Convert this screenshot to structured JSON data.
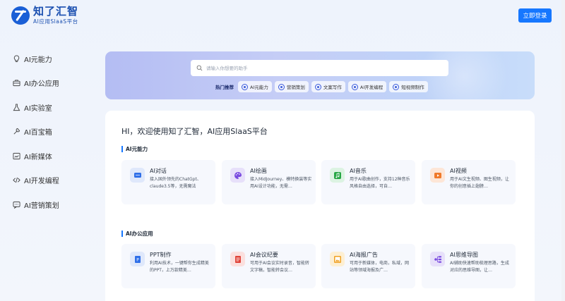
{
  "header": {
    "logo_title": "知了汇智",
    "logo_subtitle": "AI应用SlaaS平台",
    "login_label": "立即登录"
  },
  "sidebar": {
    "items": [
      {
        "label": "AI元能力",
        "icon": "lightbulb-icon"
      },
      {
        "label": "AI办公应用",
        "icon": "briefcase-icon"
      },
      {
        "label": "AI实验室",
        "icon": "flask-icon"
      },
      {
        "label": "AI百宝箱",
        "icon": "wrench-icon"
      },
      {
        "label": "AI新媒体",
        "icon": "chart-frame-icon"
      },
      {
        "label": "AI开发编程",
        "icon": "code-icon"
      },
      {
        "label": "AI营销策划",
        "icon": "chat-bubble-icon"
      }
    ]
  },
  "banner": {
    "search_placeholder": "请输入你想要的助手",
    "hot_label": "热门推荐",
    "tags": [
      "AI元能力",
      "营销策划",
      "文案写作",
      "AI开发编程",
      "短视频制作"
    ]
  },
  "main": {
    "greeting": "HI，欢迎使用知了汇智，AI应用SlaaS平台",
    "sections": [
      {
        "title": "AI元能力",
        "cards": [
          {
            "title": "AI对话",
            "desc": "接入国外领先的ChatGpt、claude3.5等，无需魔法",
            "icon": "chat-icon",
            "color": "#2f6fe8",
            "bg": "#dfe8fb"
          },
          {
            "title": "AI绘画",
            "desc": "接入MidJourney、模特换装等实用AI设计功能，无需…",
            "icon": "palette-icon",
            "color": "#7a4be0",
            "bg": "#e7e0fa"
          },
          {
            "title": "AI音乐",
            "desc": "用于AI歌曲创作，支持12种音乐风格自由选择，可自…",
            "icon": "music-icon",
            "color": "#27a745",
            "bg": "#dcf3e2"
          },
          {
            "title": "AI视频",
            "desc": "用于AI文生视频、图生视频，让你的创意插上翅膀…",
            "icon": "video-icon",
            "color": "#f07a2a",
            "bg": "#fde6d7"
          }
        ]
      },
      {
        "title": "AI办公应用",
        "cards": [
          {
            "title": "PPT制作",
            "desc": "利用AI技术，一键帮你生成精美的PPT，上万款精美…",
            "icon": "ppt-icon",
            "color": "#2f6fe8",
            "bg": "#dfe8fb"
          },
          {
            "title": "AI会议纪要",
            "desc": "可用于AI会议实时录音，智能转文字稿，智能转会议…",
            "icon": "notes-icon",
            "color": "#e0443a",
            "bg": "#fbe0de"
          },
          {
            "title": "AI海报广告",
            "desc": "可用于新媒体，电商，私域，网站等领域海报及广…",
            "icon": "poster-icon",
            "color": "#f0a020",
            "bg": "#fdefd3"
          },
          {
            "title": "AI思维导图",
            "desc": "AI辅助快速帮助梳理思路，生成对应的思维导图，让…",
            "icon": "mindmap-icon",
            "color": "#7a4be0",
            "bg": "#e7e0fa"
          }
        ]
      }
    ]
  }
}
